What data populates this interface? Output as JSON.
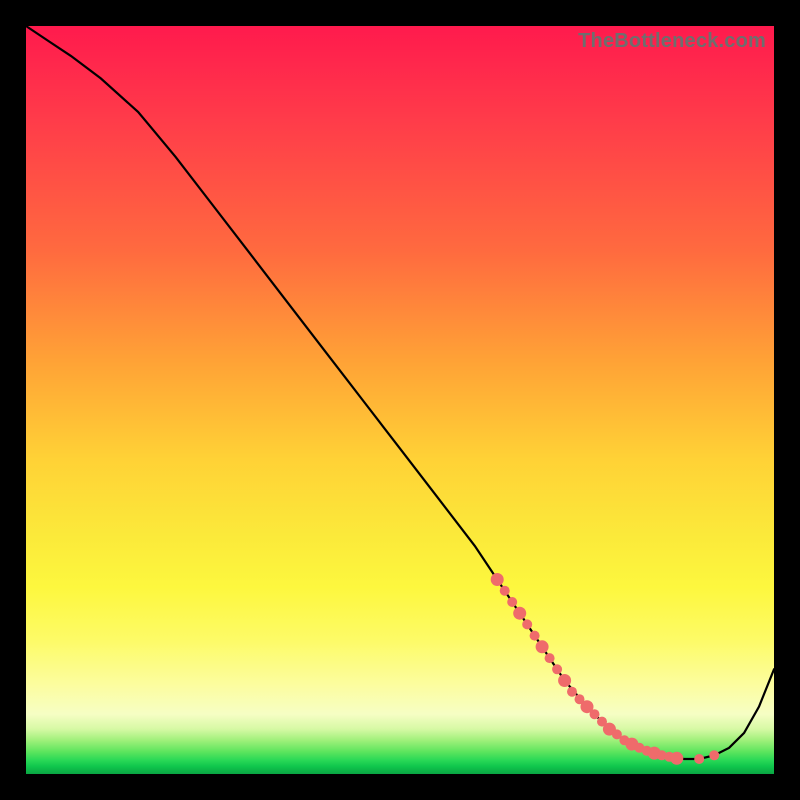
{
  "watermark": "TheBottleneck.com",
  "colors": {
    "background": "#000000",
    "curve": "#000000",
    "dots": "#ef6b6b"
  },
  "chart_data": {
    "type": "line",
    "title": "",
    "xlabel": "",
    "ylabel": "",
    "xlim": [
      0,
      100
    ],
    "ylim": [
      0,
      100
    ],
    "annotations": [
      "TheBottleneck.com"
    ],
    "series": [
      {
        "name": "bottleneck-curve",
        "x": [
          0,
          3,
          6,
          10,
          15,
          20,
          25,
          30,
          35,
          40,
          45,
          50,
          55,
          60,
          63,
          65,
          67,
          70,
          72,
          75,
          78,
          80,
          82,
          85,
          88,
          90,
          92,
          94,
          96,
          98,
          100
        ],
        "y": [
          100,
          98,
          96,
          93,
          88.5,
          82.5,
          76,
          69.5,
          63,
          56.5,
          50,
          43.5,
          37,
          30.5,
          26,
          23,
          20,
          15.5,
          12.5,
          9,
          6,
          4.5,
          3.5,
          2.5,
          2,
          2,
          2.5,
          3.5,
          5.5,
          9,
          14
        ]
      }
    ],
    "scatter_overlay": {
      "name": "highlighted-points",
      "x": [
        63,
        64,
        65,
        66,
        67,
        68,
        69,
        70,
        71,
        72,
        73,
        74,
        75,
        76,
        77,
        78,
        79,
        80,
        81,
        82,
        83,
        84,
        85,
        86,
        87,
        90,
        92
      ],
      "y": [
        26,
        24.5,
        23,
        21.5,
        20,
        18.5,
        17,
        15.5,
        14,
        12.5,
        11,
        10,
        9,
        8,
        7,
        6,
        5.3,
        4.5,
        4,
        3.5,
        3.1,
        2.8,
        2.5,
        2.3,
        2.1,
        2,
        2.5
      ]
    }
  }
}
